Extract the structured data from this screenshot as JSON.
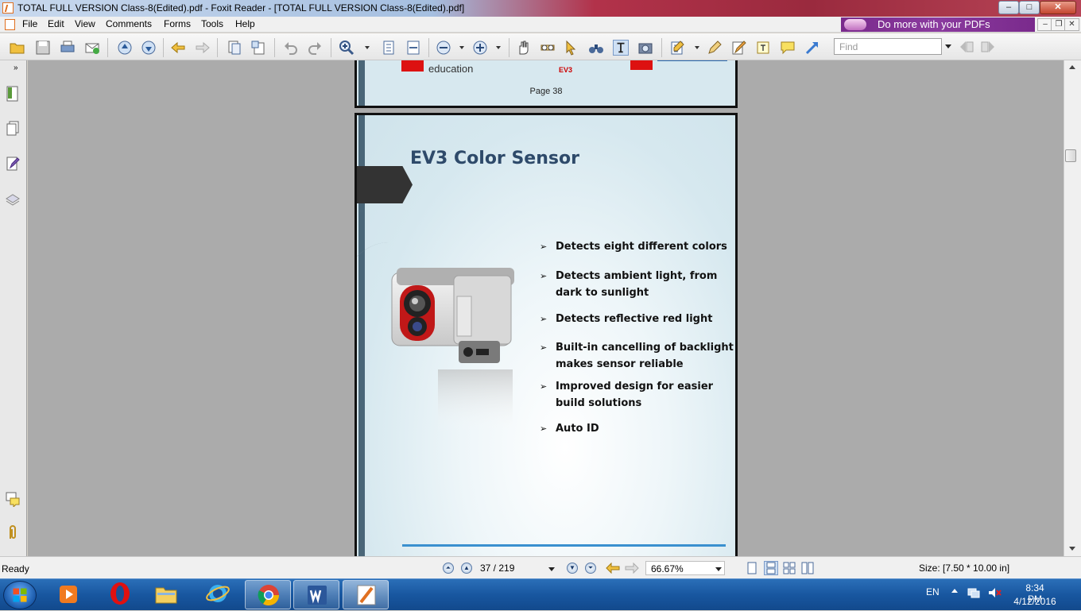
{
  "window": {
    "title": "TOTAL FULL VERSION Class-8(Edited).pdf - Foxit Reader - [TOTAL FULL VERSION Class-8(Edited).pdf]",
    "controls": {
      "minimize": "–",
      "maximize": "□",
      "close": "✕"
    }
  },
  "menu": {
    "items": [
      "File",
      "Edit",
      "View",
      "Comments",
      "Forms",
      "Tools",
      "Help"
    ],
    "promo": "Do more with your PDFs"
  },
  "toolbar": {
    "find_placeholder": "Find"
  },
  "document": {
    "previous_page": {
      "brand_text": "education",
      "ev3_label": "EV3",
      "page_label": "Page 38"
    },
    "slide": {
      "title": "EV3 Color Sensor",
      "bullet_marker": "➢",
      "bullets": [
        "Detects eight different colors",
        "Detects ambient light, from dark to sunlight",
        "Detects reflective red light",
        "Built-in cancelling of backlight makes sensor reliable",
        "Improved design for easier build solutions",
        "Auto ID"
      ]
    }
  },
  "statusbar": {
    "ready": "Ready",
    "page_indicator": "37 / 219",
    "zoom": "66.67%",
    "size": "Size: [7.50 * 10.00 in]"
  },
  "taskbar": {
    "language": "EN",
    "time": "8:34 PM",
    "date": "4/12/2016"
  },
  "colors": {
    "accent_blue": "#3a90cf",
    "slide_title": "#2e4a6a",
    "lego_red": "#dd1111",
    "promo_purple": "#7a2a8c"
  }
}
